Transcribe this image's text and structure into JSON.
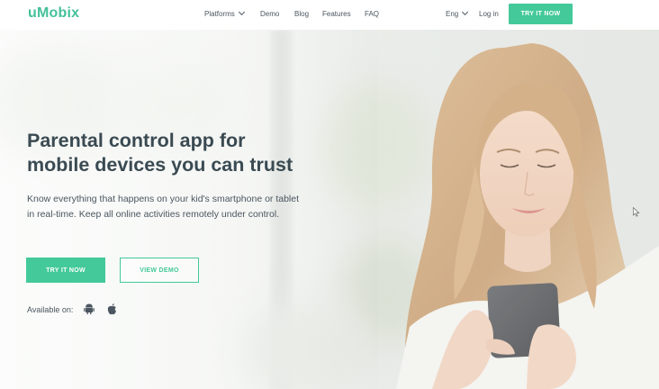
{
  "brand": {
    "logo_text": "uMobix",
    "accent_color": "#44c99a"
  },
  "nav": {
    "items": [
      {
        "label": "Platforms",
        "has_dropdown": true
      },
      {
        "label": "Demo"
      },
      {
        "label": "Blog"
      },
      {
        "label": "Features"
      },
      {
        "label": "FAQ"
      }
    ],
    "language": {
      "label": "Eng",
      "has_dropdown": true
    },
    "login_label": "Log in",
    "cta_label": "TRY IT NOW"
  },
  "hero": {
    "title_line1": "Parental control app for",
    "title_line2": "mobile devices you can trust",
    "description": "Know everything that happens on your kid's smartphone or tablet in real-time. Keep all online activities remotely under control.",
    "primary_button": "TRY IT NOW",
    "secondary_button": "VIEW DEMO",
    "available_label": "Available on:",
    "platform_icons": [
      "android-icon",
      "apple-icon"
    ]
  }
}
